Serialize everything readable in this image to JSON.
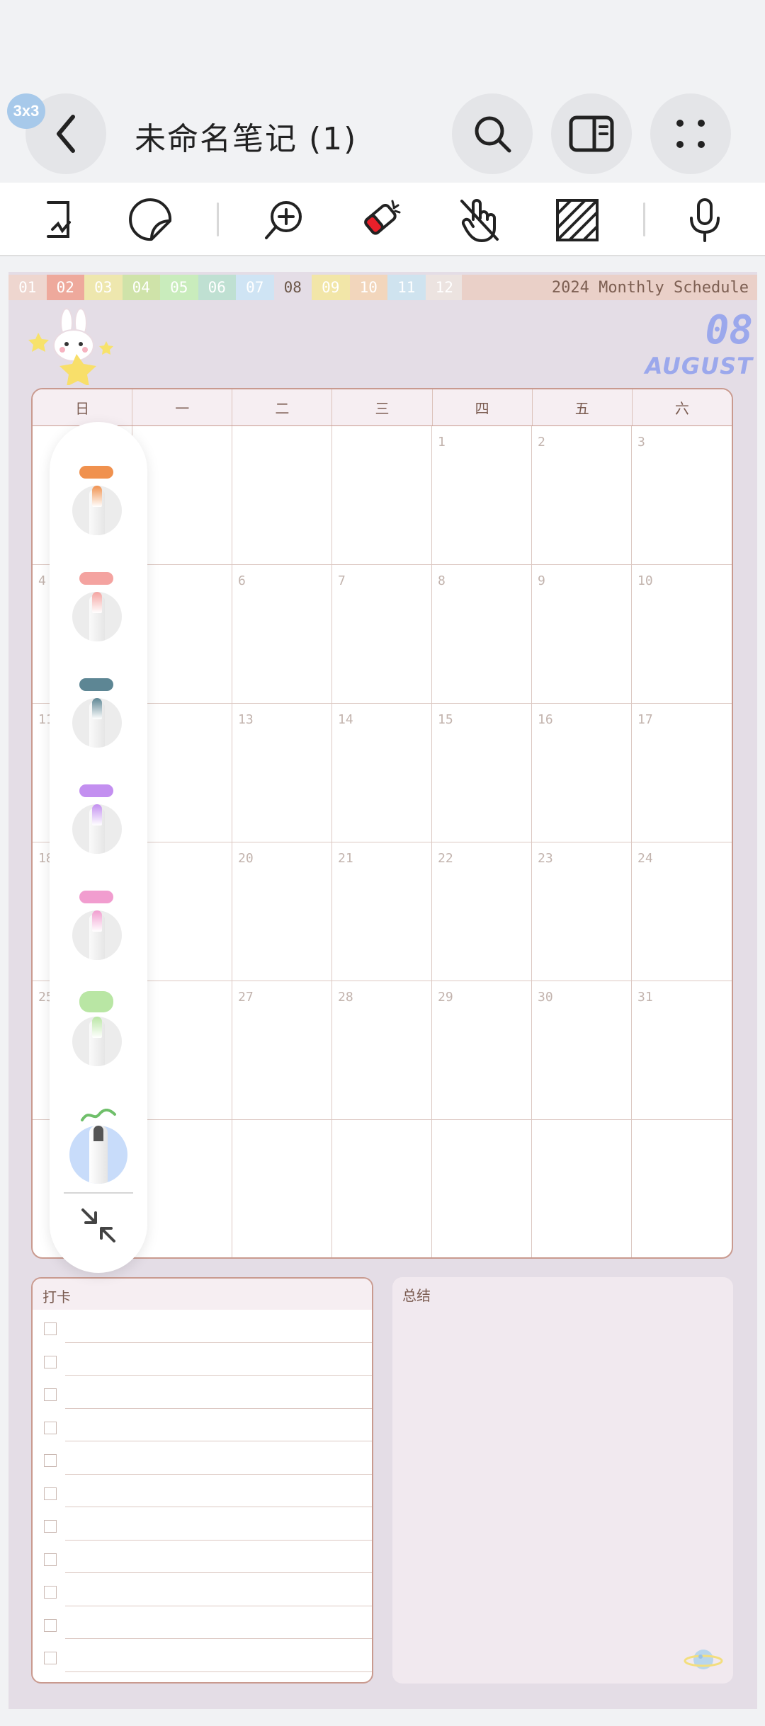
{
  "app_bar": {
    "badge": "3x3",
    "note_title": "未命名笔记 (1)"
  },
  "toolbar": {
    "tools": [
      "lasso-tool",
      "sticker-tool",
      "zoom-tool",
      "eraser-tool",
      "touch-disable-tool",
      "pattern-tool",
      "voice-tool"
    ]
  },
  "page": {
    "months": [
      "01",
      "02",
      "03",
      "04",
      "05",
      "06",
      "07",
      "08",
      "09",
      "10",
      "11",
      "12"
    ],
    "month_colors": [
      "#eed6cf",
      "#eea99c",
      "#eee7ae",
      "#cfe3a9",
      "#c9ecbc",
      "#bfe0d2",
      "#cfe4f4",
      "#e4dde6",
      "#f2e6a8",
      "#f2d6bc",
      "#cfe3ef",
      "#ece3e0"
    ],
    "schedule_title": "2024 Monthly Schedule",
    "big_month": "08",
    "month_name": "AUGUST",
    "weekdays": [
      "日",
      "一",
      "二",
      "三",
      "四",
      "五",
      "六"
    ],
    "days": [
      "",
      "",
      "",
      "",
      "1",
      "2",
      "3",
      "4",
      "",
      "6",
      "7",
      "8",
      "9",
      "10",
      "11",
      "",
      "13",
      "14",
      "15",
      "16",
      "17",
      "18",
      "",
      "20",
      "21",
      "22",
      "23",
      "24",
      "25",
      "",
      "27",
      "28",
      "29",
      "30",
      "31",
      "",
      "",
      "",
      "",
      "",
      "",
      ""
    ],
    "checkin_title": "打卡",
    "summary_title": "总结"
  },
  "palette": {
    "pens": [
      {
        "color": "#f0914e",
        "name": "orange-pen"
      },
      {
        "color": "#f4a3a0",
        "name": "salmon-pen"
      },
      {
        "color": "#5d8694",
        "name": "teal-pen"
      },
      {
        "color": "#c38ff0",
        "name": "purple-pen"
      },
      {
        "color": "#f19dcf",
        "name": "pink-pen"
      },
      {
        "color": "#b9e6a4",
        "name": "green-pen"
      }
    ],
    "selected_tool_accent": "#c8dcfa"
  }
}
